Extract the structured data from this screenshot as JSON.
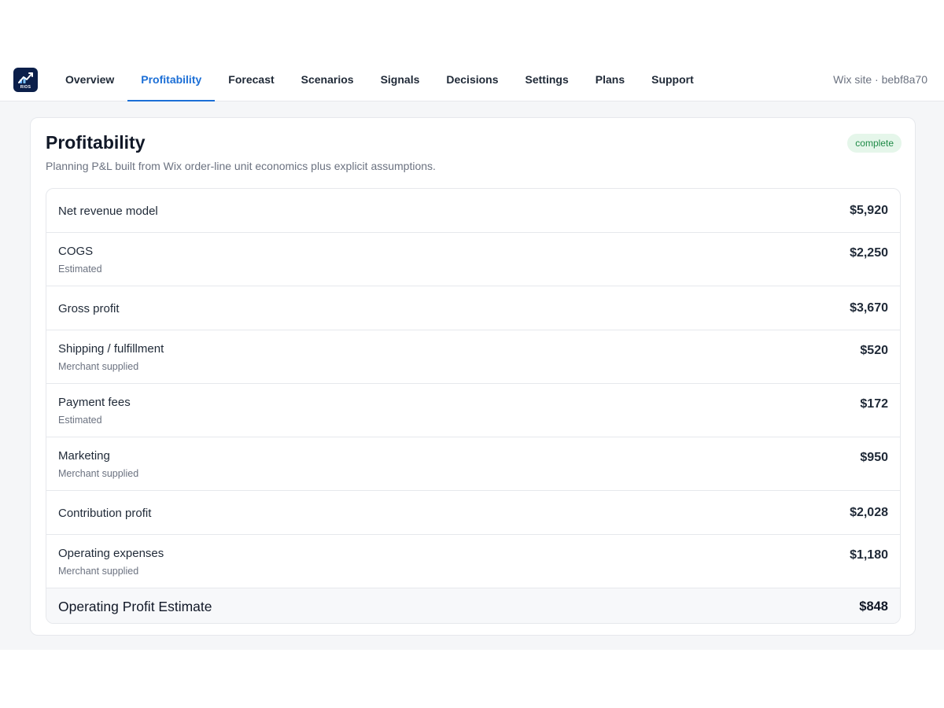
{
  "brand": {
    "logo_text": "RIOS"
  },
  "nav": {
    "tabs": [
      {
        "label": "Overview"
      },
      {
        "label": "Profitability"
      },
      {
        "label": "Forecast"
      },
      {
        "label": "Scenarios"
      },
      {
        "label": "Signals"
      },
      {
        "label": "Decisions"
      },
      {
        "label": "Settings"
      },
      {
        "label": "Plans"
      },
      {
        "label": "Support"
      }
    ],
    "active_tab": "Profitability",
    "site_label": "Wix site · bebf8a70"
  },
  "card": {
    "title": "Profitability",
    "subtitle": "Planning P&L built from Wix order-line unit economics plus explicit assumptions.",
    "status_badge": "complete"
  },
  "pl_rows": [
    {
      "label": "Net revenue model",
      "sublabel": "",
      "value": "$5,920"
    },
    {
      "label": "COGS",
      "sublabel": "Estimated",
      "value": "$2,250"
    },
    {
      "label": "Gross profit",
      "sublabel": "",
      "value": "$3,670"
    },
    {
      "label": "Shipping / fulfillment",
      "sublabel": "Merchant supplied",
      "value": "$520"
    },
    {
      "label": "Payment fees",
      "sublabel": "Estimated",
      "value": "$172"
    },
    {
      "label": "Marketing",
      "sublabel": "Merchant supplied",
      "value": "$950"
    },
    {
      "label": "Contribution profit",
      "sublabel": "",
      "value": "$2,028"
    },
    {
      "label": "Operating expenses",
      "sublabel": "Merchant supplied",
      "value": "$1,180"
    },
    {
      "label": "Operating Profit Estimate",
      "sublabel": "",
      "value": "$848"
    }
  ],
  "colors": {
    "accent": "#1c6fd6",
    "badge_bg": "#e5f6ea",
    "badge_text": "#1e8a46",
    "page_bg": "#f5f6f8",
    "logo_bg": "#0b1f4a"
  },
  "icons": {
    "logo": "chart-growth-icon"
  }
}
